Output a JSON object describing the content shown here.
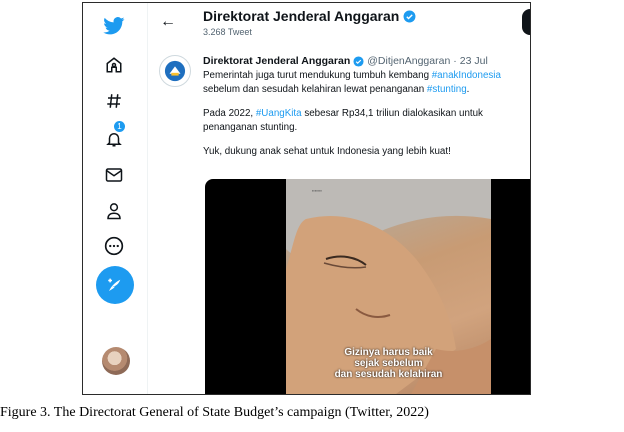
{
  "colors": {
    "accent": "#1d9bf0",
    "text": "#0f1419",
    "muted": "#536471"
  },
  "sidebar": {
    "items": [
      {
        "icon": "twitter-bird-icon"
      },
      {
        "icon": "home-icon"
      },
      {
        "icon": "hashtag-icon"
      },
      {
        "icon": "notifications-icon",
        "badge": "1"
      },
      {
        "icon": "messages-icon"
      },
      {
        "icon": "profile-icon"
      },
      {
        "icon": "more-icon"
      },
      {
        "icon": "compose-tweet-icon"
      }
    ]
  },
  "header": {
    "back_icon": "arrow-left-icon",
    "title": "Direktorat Jenderal Anggaran",
    "subtitle": "3.268 Tweet"
  },
  "tweet": {
    "name": "Direktorat Jenderal Anggaran",
    "handle": "@DitjenAnggaran",
    "separator": "·",
    "date": "23 Jul",
    "line1_text": "Pemerintah juga turut mendukung tumbuh kembang ",
    "line1_tag": "#anakIndonesia",
    "line2_text": "sebelum dan sesudah kelahiran lewat penanganan ",
    "line2_tag": "#stunting",
    "line2_end": ".",
    "p2_start": "Pada 2022, ",
    "p2_tag": "#UangKita",
    "p2_rest": " sebesar Rp34,1 triliun dialokasikan untuk",
    "p2_line2": "penanganan stunting.",
    "p3": "Yuk, dukung anak sehat untuk Indonesia yang lebih kuat!",
    "media_caption": [
      "Gizinya harus baik",
      "sejak sebelum",
      "dan sesudah kelahiran"
    ]
  },
  "figure_caption": "Figure 3. The Directorat General of State Budget’s campaign (Twitter, 2022)"
}
